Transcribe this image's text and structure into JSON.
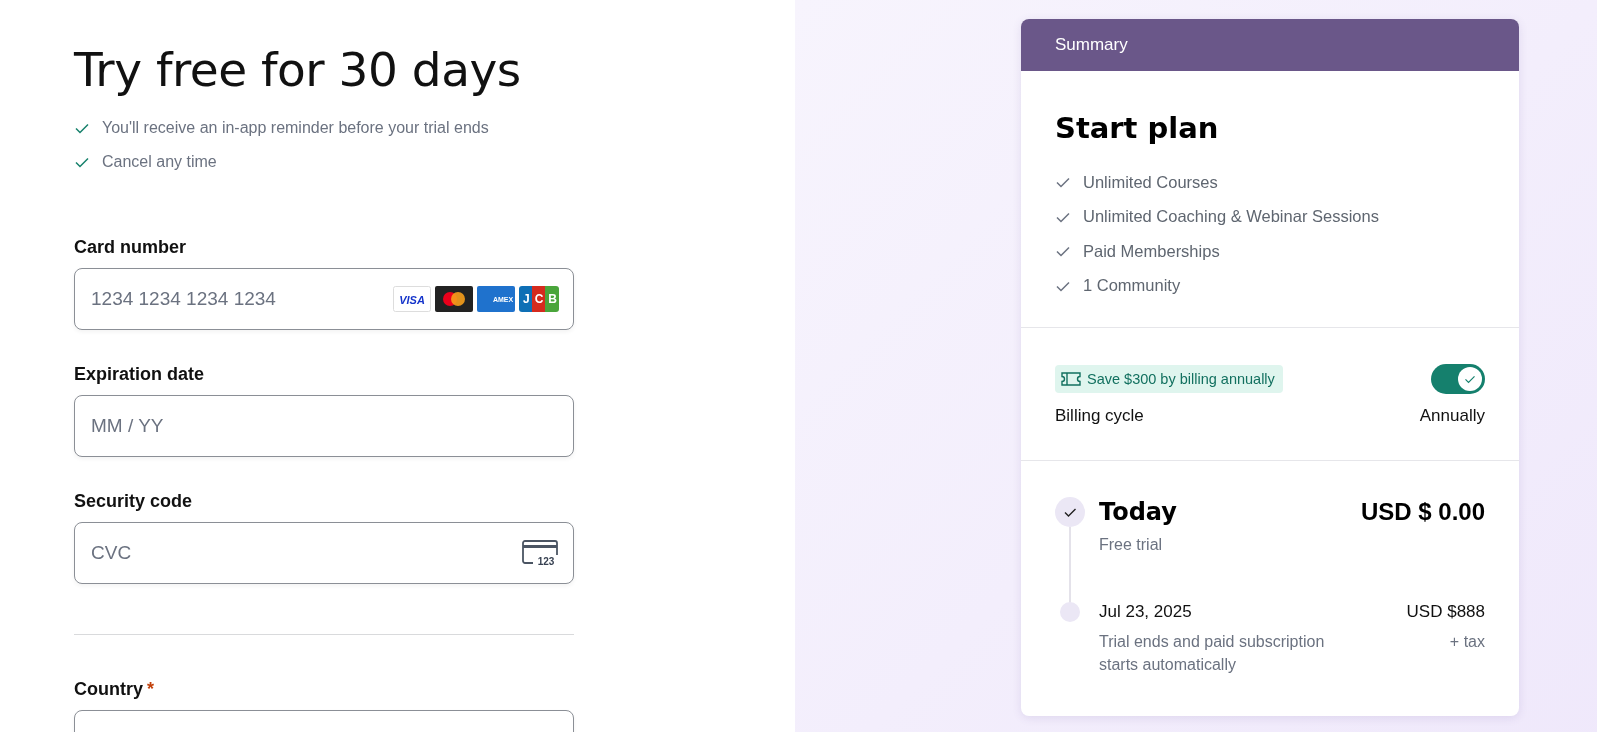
{
  "title": "Try free for 30 days",
  "perks": [
    "You'll receive an in-app reminder before your trial ends",
    "Cancel any time"
  ],
  "fields": [
    {
      "kind": "card",
      "label": "Card number",
      "required": false,
      "placeholder": "1234 1234 1234 1234",
      "brands": [
        {
          "kind": "visa",
          "label": "VISA"
        },
        {
          "kind": "mastercard"
        },
        {
          "kind": "amex",
          "label": "AMEX"
        },
        {
          "kind": "jcb",
          "label": "JCB"
        }
      ]
    },
    {
      "kind": "text",
      "label": "Expiration date",
      "required": false,
      "placeholder": "MM / YY"
    },
    {
      "kind": "cvc",
      "label": "Security code",
      "required": false,
      "placeholder": "CVC",
      "icon_label": "123"
    },
    {
      "kind": "divider"
    },
    {
      "kind": "text",
      "label": "Country",
      "required": true,
      "required_mark": "*"
    }
  ],
  "summary": {
    "header": "Summary",
    "plan": "Start plan",
    "features": [
      "Unlimited Courses",
      "Unlimited Coaching & Webinar Sessions",
      "Paid Memberships",
      "1 Community"
    ],
    "promo": "Save $300 by billing annually",
    "billing": {
      "label": "Billing cycle",
      "value": "Annually",
      "on": true
    },
    "timeline": [
      {
        "kind": "main",
        "done": true,
        "title": "Today",
        "amount": "USD $ 0.00",
        "note": "Free trial"
      },
      {
        "kind": "minor",
        "done": false,
        "title": "Jul 23, 2025",
        "amount": "USD $888",
        "note": "Trial ends and paid subscription starts automatically",
        "extra": "+ tax"
      }
    ]
  }
}
